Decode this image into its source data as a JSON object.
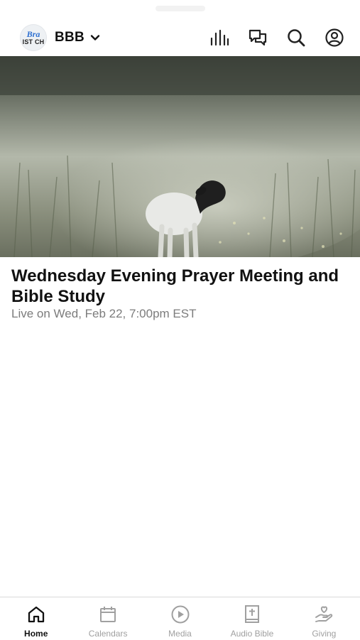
{
  "header": {
    "logo_line1": "Bra",
    "logo_line2": "IST CH",
    "church_name": "BBB",
    "icons": [
      "chevron-down-icon",
      "audio-bars-icon",
      "chat-bubbles-icon",
      "search-icon",
      "account-icon"
    ]
  },
  "featured": {
    "title": "Wednesday Evening Prayer Meeting and Bible Study",
    "subtitle": "Live on Wed, Feb 22, 7:00pm EST"
  },
  "tabbar": {
    "items": [
      {
        "label": "Home",
        "icon": "home-icon",
        "active": true
      },
      {
        "label": "Calendars",
        "icon": "calendar-icon",
        "active": false
      },
      {
        "label": "Media",
        "icon": "play-circle-icon",
        "active": false
      },
      {
        "label": "Audio Bible",
        "icon": "bible-icon",
        "active": false
      },
      {
        "label": "Giving",
        "icon": "giving-icon",
        "active": false
      }
    ]
  },
  "colors": {
    "accent_text": "#111111",
    "inactive_tab": "#a0a0a0",
    "logo_blue": "#2d6fd1"
  }
}
